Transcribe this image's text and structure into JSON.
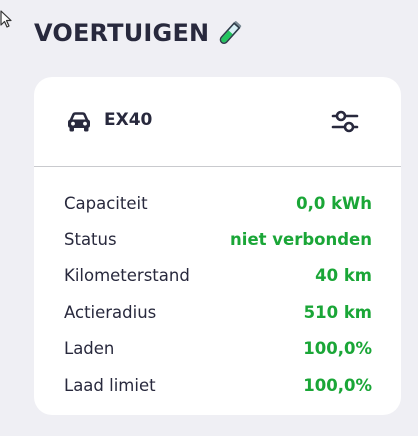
{
  "header": {
    "title": "VOERTUIGEN",
    "icon": "test-tube-icon"
  },
  "vehicle": {
    "name": "EX40",
    "icon": "car-icon",
    "settings_icon": "sliders-icon"
  },
  "colors": {
    "value": "#1aa637",
    "text": "#28293d",
    "background": "#efeff4",
    "card": "#ffffff"
  },
  "details": [
    {
      "label": "Capaciteit",
      "value": "0,0 kWh"
    },
    {
      "label": "Status",
      "value": "niet verbonden"
    },
    {
      "label": "Kilometerstand",
      "value": "40 km"
    },
    {
      "label": "Actieradius",
      "value": "510 km"
    },
    {
      "label": "Laden",
      "value": "100,0%"
    },
    {
      "label": "Laad limiet",
      "value": "100,0%"
    }
  ]
}
